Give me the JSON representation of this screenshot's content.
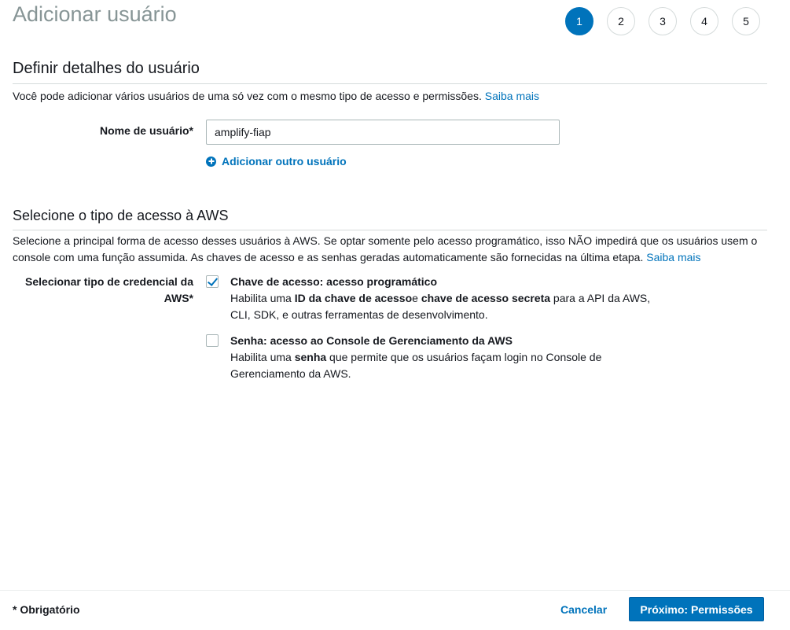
{
  "header": {
    "title": "Adicionar usuário",
    "steps": [
      "1",
      "2",
      "3",
      "4",
      "5"
    ],
    "active_step": 1
  },
  "details": {
    "heading": "Definir detalhes do usuário",
    "description": "Você pode adicionar vários usuários de uma só vez com o mesmo tipo de acesso e permissões.",
    "learn_more": "Saiba mais",
    "username_label": "Nome de usuário*",
    "username_value": "amplify-fiap",
    "add_user_label": "Adicionar outro usuário"
  },
  "access": {
    "heading": "Selecione o tipo de acesso à AWS",
    "description": "Selecione a principal forma de acesso desses usuários à AWS. Se optar somente pelo acesso programático, isso NÃO impedirá que os usuários usem o console com uma função assumida. As chaves de acesso e as senhas geradas automaticamente são fornecidas na última etapa.",
    "learn_more": "Saiba mais",
    "credential_label": "Selecionar tipo de credencial da AWS*",
    "options": [
      {
        "title": "Chave de acesso: acesso programático",
        "checked": true,
        "body_1": "Habilita uma ",
        "bold_1": "ID da chave de acesso",
        "body_2": "e ",
        "bold_2": "chave de acesso secreta",
        "body_3": " para a API da AWS, CLI, SDK, e outras ferramentas de desenvolvimento."
      },
      {
        "title": "Senha: acesso ao Console de Gerenciamento da AWS",
        "checked": false,
        "body_1": "Habilita uma ",
        "bold_1": "senha",
        "body_2": " que permite que os usuários façam login no Console de Gerenciamento da AWS."
      }
    ]
  },
  "footer": {
    "required_note": "* Obrigatório",
    "cancel_label": "Cancelar",
    "next_label": "Próximo: Permissões"
  },
  "colors": {
    "accent": "#0073bb",
    "title_gray": "#879596"
  }
}
